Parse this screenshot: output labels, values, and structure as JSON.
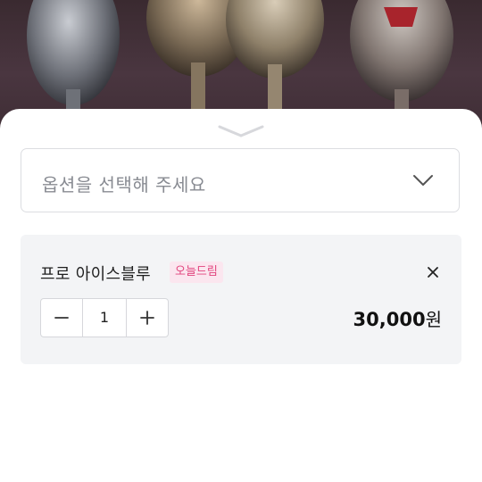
{
  "option_select": {
    "placeholder": "옵션을 선택해 주세요",
    "icon": "chevron-down-icon"
  },
  "selected_item": {
    "name": "프로 아이스블루",
    "seller": "오늘드림",
    "quantity": "1",
    "price_amount": "30,000",
    "price_unit": "원"
  },
  "colors": {
    "badge_text": "#e2447e",
    "badge_bg": "#fbe6ef",
    "card_bg": "#f3f4f6"
  },
  "icons": {
    "sheet_handle": "chevron-down-icon",
    "remove": "close-icon",
    "decrease": "minus-icon",
    "increase": "plus-icon"
  }
}
